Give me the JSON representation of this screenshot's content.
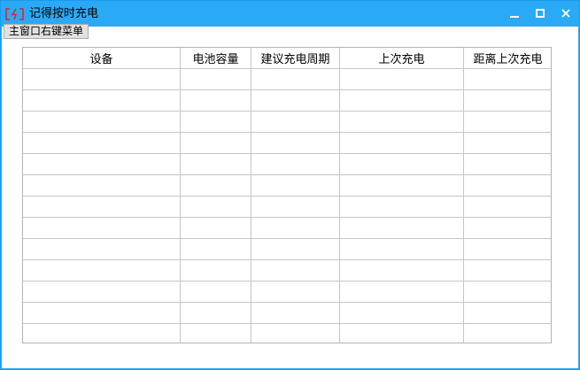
{
  "window": {
    "title": "记得按时充电",
    "icon": "battery-charging-icon",
    "controls": [
      "minimize-icon",
      "maximize-icon",
      "close-icon"
    ]
  },
  "toolbar": {
    "menu_button_label": "主窗口右键菜单"
  },
  "table": {
    "columns": [
      "设备",
      "电池容量",
      "建议充电周期",
      "上次充电",
      "距离上次充电"
    ],
    "rows": [
      [
        "",
        "",
        "",
        "",
        ""
      ],
      [
        "",
        "",
        "",
        "",
        ""
      ],
      [
        "",
        "",
        "",
        "",
        ""
      ],
      [
        "",
        "",
        "",
        "",
        ""
      ],
      [
        "",
        "",
        "",
        "",
        ""
      ],
      [
        "",
        "",
        "",
        "",
        ""
      ],
      [
        "",
        "",
        "",
        "",
        ""
      ],
      [
        "",
        "",
        "",
        "",
        ""
      ],
      [
        "",
        "",
        "",
        "",
        ""
      ],
      [
        "",
        "",
        "",
        "",
        ""
      ],
      [
        "",
        "",
        "",
        "",
        ""
      ],
      [
        "",
        "",
        "",
        "",
        ""
      ],
      [
        "",
        "",
        "",
        "",
        ""
      ]
    ]
  },
  "colors": {
    "titlebar": "#2aaaf6",
    "icon_red": "#d8282e",
    "grid_line": "#c6c6c6"
  }
}
